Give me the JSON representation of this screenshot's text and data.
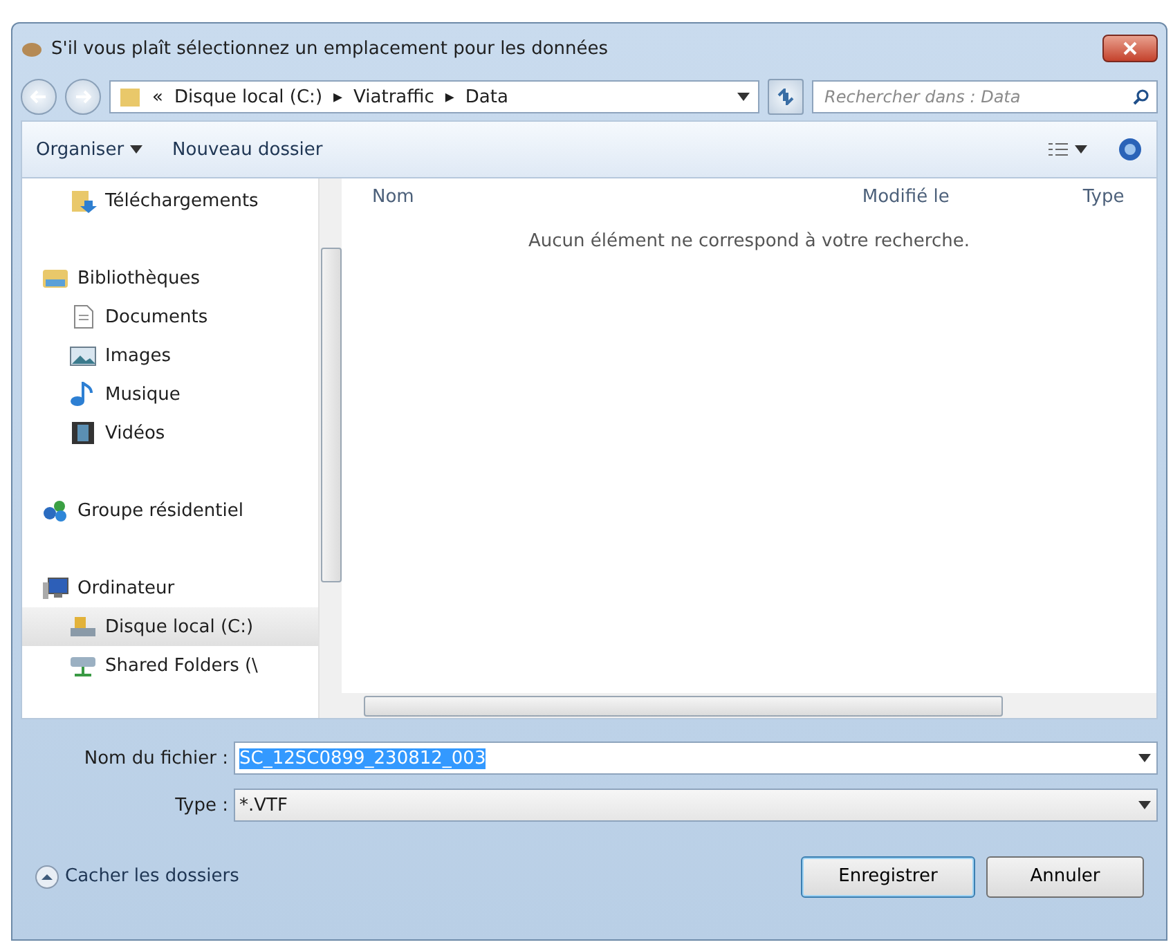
{
  "window": {
    "title": "S'il vous plaît sélectionnez un emplacement pour les données"
  },
  "address": {
    "prefix": "«",
    "crumbs": [
      "Disque local (C:)",
      "Viatraffic",
      "Data"
    ],
    "separator": "▸"
  },
  "search": {
    "placeholder": "Rechercher dans : Data"
  },
  "toolbar": {
    "organize": "Organiser",
    "new_folder": "Nouveau dossier"
  },
  "sidebar": {
    "groups": [
      {
        "children": [
          {
            "label": "Téléchargements",
            "kind": "download",
            "selected": false
          }
        ]
      },
      {
        "label": "Bibliothèques",
        "kind": "library",
        "children": [
          {
            "label": "Documents",
            "kind": "document",
            "selected": false
          },
          {
            "label": "Images",
            "kind": "image",
            "selected": false
          },
          {
            "label": "Musique",
            "kind": "music",
            "selected": false
          },
          {
            "label": "Vidéos",
            "kind": "video",
            "selected": false
          }
        ]
      },
      {
        "label": "Groupe résidentiel",
        "kind": "homegroup"
      },
      {
        "label": "Ordinateur",
        "kind": "computer",
        "children": [
          {
            "label": "Disque local (C:)",
            "kind": "drive",
            "selected": true
          },
          {
            "label": "Shared Folders (\\",
            "kind": "network",
            "selected": false
          }
        ]
      }
    ]
  },
  "table": {
    "columns": [
      "Nom",
      "Modifié le",
      "Type"
    ],
    "empty_message": "Aucun élément ne correspond à votre recherche."
  },
  "form": {
    "filename_label": "Nom du fichier :",
    "filename": "SC_12SC0899_230812_003",
    "type_label": "Type :",
    "type": "*.VTF"
  },
  "footer": {
    "toggle": "Cacher les dossiers",
    "buttons": [
      {
        "label": "Enregistrer",
        "default": true
      },
      {
        "label": "Annuler",
        "default": false
      }
    ]
  }
}
